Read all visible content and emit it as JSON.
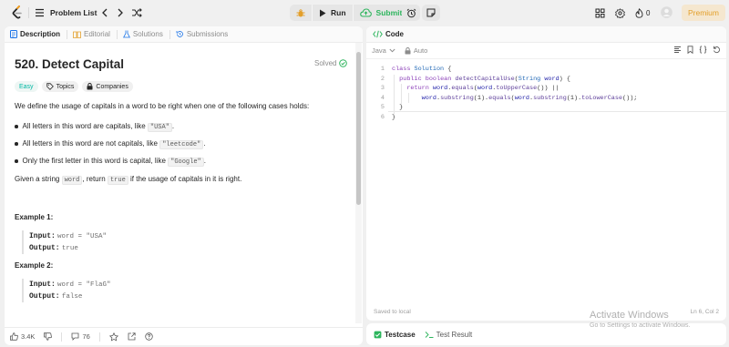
{
  "topbar": {
    "problem_list_label": "Problem List",
    "run_label": "Run",
    "submit_label": "Submit",
    "streak_count": "0",
    "premium_label": "Premium"
  },
  "left_tabs": [
    {
      "label": "Description"
    },
    {
      "label": "Editorial"
    },
    {
      "label": "Solutions"
    },
    {
      "label": "Submissions"
    }
  ],
  "problem": {
    "title": "520. Detect Capital",
    "status": "Solved",
    "difficulty": "Easy",
    "topics_label": "Topics",
    "companies_label": "Companies",
    "intro": "We define the usage of capitals in a word to be right when one of the following cases holds:",
    "bullets": [
      {
        "text": "All letters in this word are capitals, like ",
        "code": "\"USA\"",
        "end": "."
      },
      {
        "text": "All letters in this word are not capitals, like ",
        "code": "\"leetcode\"",
        "end": "."
      },
      {
        "text": "Only the first letter in this word is capital, like ",
        "code": "\"Google\"",
        "end": "."
      }
    ],
    "task_a": "Given a string ",
    "task_code1": "word",
    "task_b": ", return ",
    "task_code2": "true",
    "task_c": " if the usage of capitals in it is right.",
    "examples": [
      {
        "heading": "Example 1:",
        "input_label": "Input:",
        "input": "word = \"USA\"",
        "output_label": "Output:",
        "output": "true"
      },
      {
        "heading": "Example 2:",
        "input_label": "Input:",
        "input": "word = \"FlaG\"",
        "output_label": "Output:",
        "output": "false"
      }
    ]
  },
  "bottom_bar": {
    "likes": "3.4K",
    "comments": "76"
  },
  "code_panel": {
    "title": "Code",
    "language": "Java",
    "auto_label": "Auto",
    "line_numbers": [
      "1",
      "2",
      "3",
      "4",
      "5",
      "6"
    ],
    "saved_label": "Saved to local",
    "cursor_pos": "Ln 6, Col 2"
  },
  "result_tabs": [
    {
      "label": "Testcase"
    },
    {
      "label": "Test Result"
    }
  ],
  "watermark": {
    "line1": "Activate Windows",
    "line2": "Go to Settings to activate Windows."
  },
  "colors": {
    "accent_green": "#2db55d",
    "easy": "#00b8a3",
    "premium": "#e39f2a",
    "keyword": "#8b3fb8"
  }
}
